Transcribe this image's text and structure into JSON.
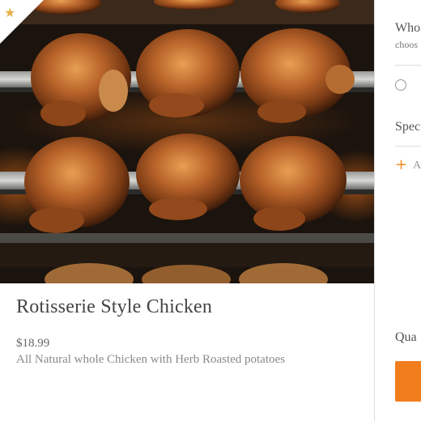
{
  "item": {
    "title": "Rotisserie Style Chicken",
    "price": "$18.99",
    "description": "All Natural whole Chicken with Herb Roasted potatoes",
    "favorite_icon": "star-icon",
    "image_subject": "rotisserie-chickens-photo"
  },
  "options_panel": {
    "choice_heading": "Who",
    "choice_subtext": "choos",
    "special_heading": "Spec",
    "add_instructions_text": "A",
    "add_instructions_icon": "plus-icon",
    "quantity_label": "Qua",
    "add_button_label": ""
  },
  "colors": {
    "accent": "#f27d1c",
    "star": "#e8b04a"
  }
}
